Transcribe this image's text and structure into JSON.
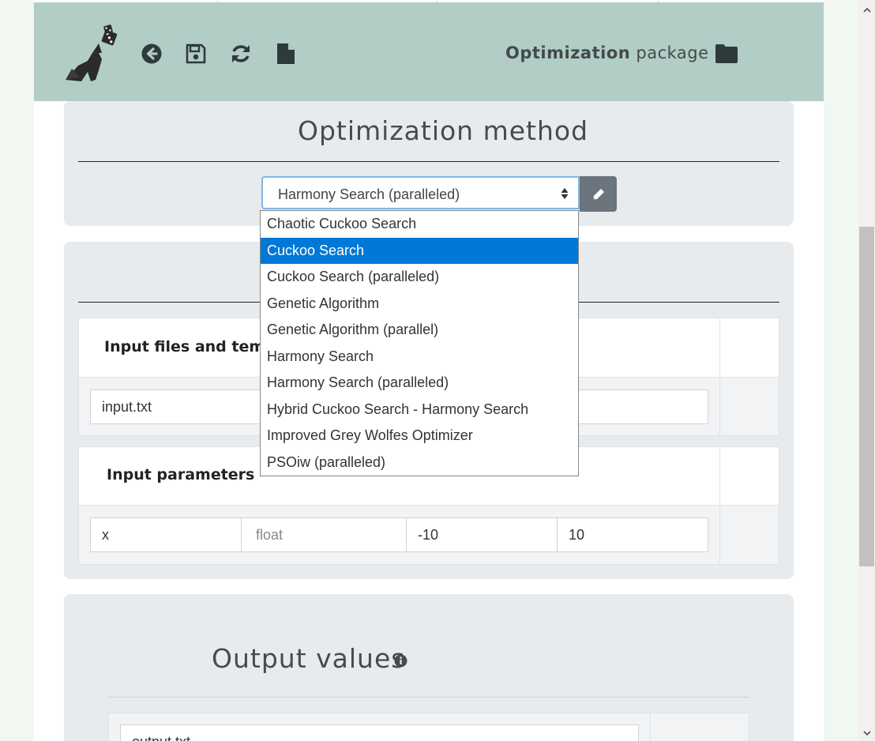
{
  "header": {
    "title_bold": "Optimization",
    "title_rest": " package",
    "icons": [
      "back-arrow-icon",
      "save-icon",
      "refresh-icon",
      "file-icon",
      "folder-icon"
    ],
    "bg_color": "#b2cdc6"
  },
  "method_card": {
    "title": "Optimization method",
    "selected": "Harmony Search (paralleled)",
    "options": [
      "Chaotic Cuckoo Search",
      "Cuckoo Search",
      "Cuckoo Search (paralleled)",
      "Genetic Algorithm",
      "Genetic Algorithm (parallel)",
      "Harmony Search",
      "Harmony Search (paralleled)",
      "Hybrid Cuckoo Search - Harmony Search",
      "Improved Grey Wolfes Optimizer",
      "PSOiw (paralleled)"
    ],
    "highlighted_option": "Cuckoo Search",
    "highlight_color": "#0078d7"
  },
  "input_card": {
    "files_label": "Input files and tem",
    "file_value": "input.txt",
    "params_label": "Input parameters",
    "param_row": {
      "name": "x",
      "type_placeholder": "float",
      "min": "-10",
      "max": "10"
    }
  },
  "output_card": {
    "title": "Output values",
    "file_value": "output.txt"
  }
}
